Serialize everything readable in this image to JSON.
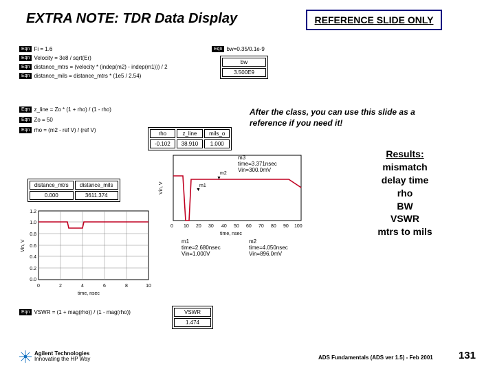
{
  "title": "EXTRA NOTE: TDR Data Display",
  "ref_box": "REFERENCE SLIDE ONLY",
  "note": "After the class, you can use this slide as a\nreference if you need it!",
  "results": {
    "heading": "Results:",
    "items": [
      "mismatch",
      "delay time",
      "rho",
      "BW",
      "VSWR",
      "mtrs to mils"
    ]
  },
  "footer": "ADS Fundamentals (ADS ver 1.5) - Feb 2001",
  "page_num": "131",
  "logo": {
    "line1": "Agilent Technologies",
    "line2": "Innovating the HP Way"
  },
  "eqns_block1": [
    "Fi = 1.6",
    "Velocity = 3e8 / sqrt(Er)",
    "distance_mtrs = (velocity * (indep(m2) - indep(m1))) / 2",
    "distance_mils = distance_mtrs * (1e5 / 2.54)"
  ],
  "eqns_block2": [
    "z_line = Zo * (1 + rho) / (1 - rho)",
    "Zo = 50",
    "rho = (m2 - ref V) / (ref V)"
  ],
  "eqn_bw": {
    "label": "bw=0.35/0.1e-9",
    "readout": {
      "cols": [
        "bw"
      ],
      "vals": [
        "3.500E9"
      ]
    }
  },
  "eqn_vswr": "VSWR = (1 + mag(rho)) / (1 - mag(rho))",
  "distance_readout": {
    "cols": [
      "distance_mtrs",
      "distance_mils"
    ],
    "vals": [
      "0.000",
      "3611.374"
    ]
  },
  "rho_readout": {
    "cols": [
      "rho",
      "z_line",
      "mils_o"
    ],
    "vals": [
      "-0.102",
      "38.910",
      "1.000"
    ]
  },
  "vswr_readout": {
    "cols": [
      "VSWR"
    ],
    "vals": [
      "1.474"
    ]
  },
  "upper_plot": {
    "ylabel": "Vin, V",
    "xlabel": "time, nsec",
    "xticks": [
      "0",
      "10",
      "20",
      "30",
      "40",
      "50",
      "60",
      "70",
      "80",
      "90",
      "100"
    ],
    "m3": "m3\ntime=3.371nsec\nVin=300.0mV",
    "m1": {
      "name": "m1",
      "caption": "m1\ntime=2.680nsec\nVin=1.000V"
    },
    "m2": {
      "name": "m2",
      "caption": "m2\ntime=4.050nsec\nVin=896.0mV"
    }
  },
  "chart_data": [
    {
      "type": "line",
      "title": "Vin vs time (upper TDR trace)",
      "xlabel": "time, nsec",
      "ylabel": "Vin, V",
      "xlim": [
        0,
        100
      ],
      "ylim": [
        0,
        1.2
      ],
      "markers": [
        {
          "name": "m1",
          "x": 2.68,
          "y": 1.0
        },
        {
          "name": "m2",
          "x": 4.05,
          "y": 0.896
        },
        {
          "name": "m3",
          "x": 3.371,
          "y": 0.3
        }
      ]
    },
    {
      "type": "line",
      "title": "Vin vs time (lower detail trace)",
      "xlabel": "time, nsec",
      "ylabel": "Vin, V",
      "xlim": [
        0,
        10
      ],
      "ylim": [
        0,
        1.2
      ],
      "yticks": [
        0,
        0.2,
        0.4,
        0.6,
        0.8,
        1.0,
        1.2
      ],
      "grid": true,
      "series": [
        {
          "name": "Vin",
          "approx_points": [
            [
              0,
              1.0
            ],
            [
              2.6,
              1.0
            ],
            [
              2.7,
              0.9
            ],
            [
              4.0,
              0.9
            ],
            [
              4.1,
              1.0
            ],
            [
              10,
              1.0
            ]
          ]
        }
      ]
    }
  ]
}
